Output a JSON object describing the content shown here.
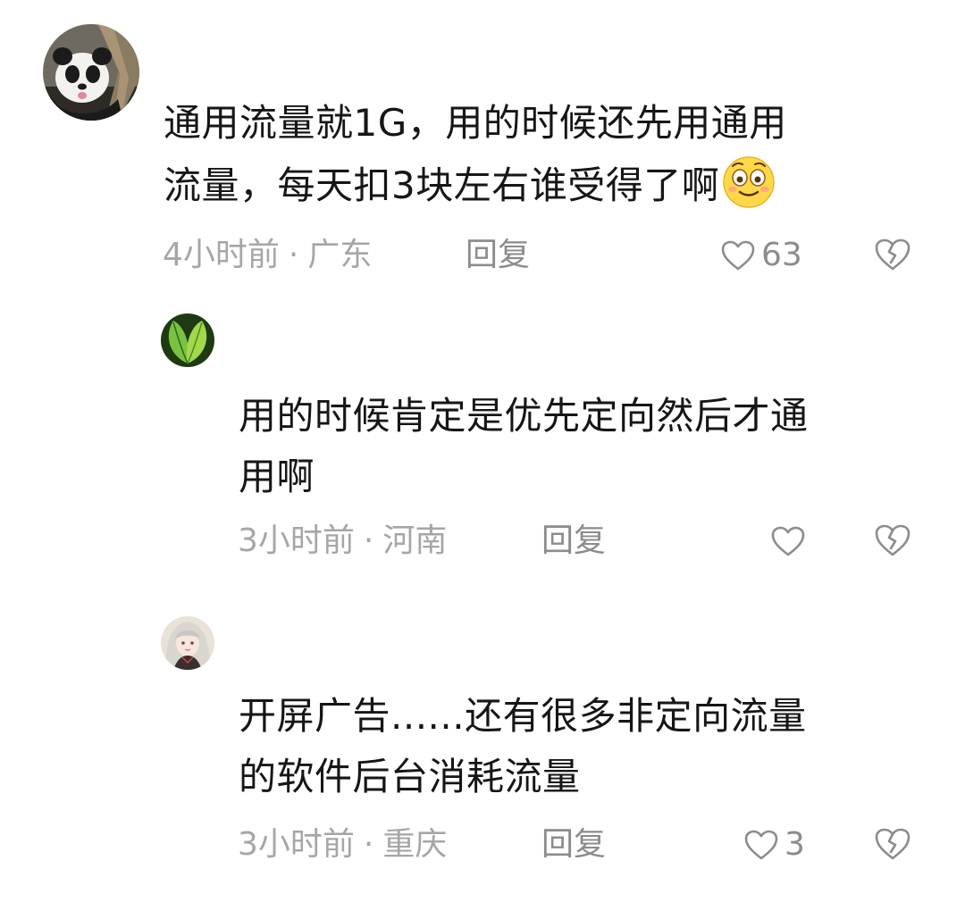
{
  "comments": [
    {
      "text_lines": [
        "通用流量就1G，用的时候还先用通用",
        "流量，每天扣3块左右谁受得了啊"
      ],
      "emoji": "smiling-face-icon",
      "time": "4小时前",
      "location": "广东",
      "reply_label": "回复",
      "likes": "63",
      "avatar": "panda-avatar"
    },
    {
      "text_lines": [
        "用的时候肯定是优先定向然后才通",
        "用啊"
      ],
      "time": "3小时前",
      "location": "河南",
      "reply_label": "回复",
      "likes": "",
      "avatar": "green-leaf-avatar"
    },
    {
      "text_lines": [
        "开屏广告......还有很多非定向流量",
        "的软件后台消耗流量"
      ],
      "time": "3小时前",
      "location": "重庆",
      "reply_label": "回复",
      "likes": "3",
      "avatar": "anime-girl-avatar"
    }
  ],
  "separator": "·",
  "colors": {
    "text": "#161616",
    "meta": "#a6a6a6",
    "icon": "#8c8c8c",
    "emoji": "#ffd84a"
  }
}
